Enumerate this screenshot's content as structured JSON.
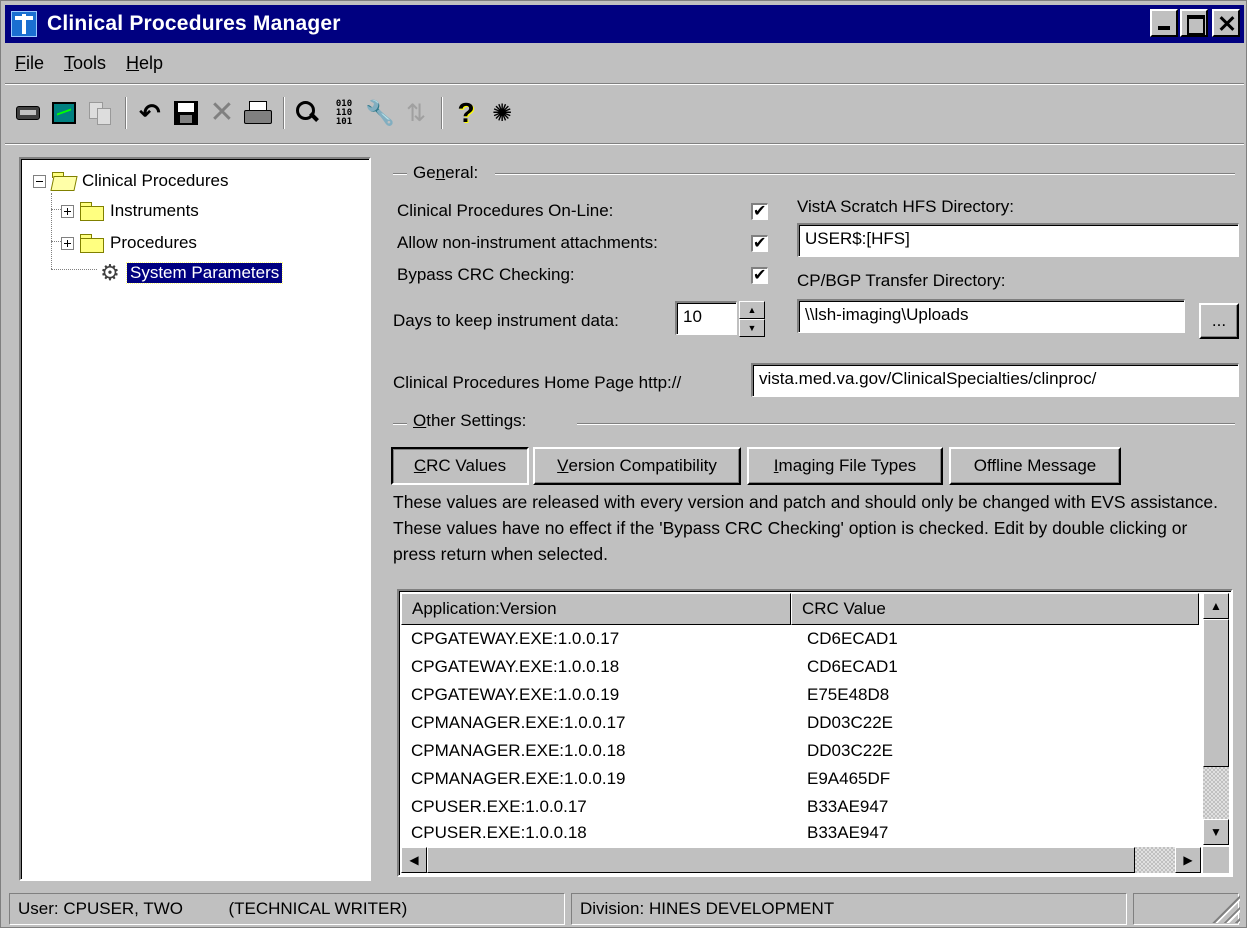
{
  "window": {
    "title": "Clinical Procedures Manager"
  },
  "menu": [
    {
      "label": "File",
      "accel": "F",
      "rest": "ile"
    },
    {
      "label": "Tools",
      "accel": "T",
      "rest": "ools"
    },
    {
      "label": "Help",
      "accel": "H",
      "rest": "elp"
    }
  ],
  "tree": {
    "root": "Clinical Procedures",
    "items": [
      "Instruments",
      "Procedures",
      "System Parameters"
    ],
    "selected": "System Parameters"
  },
  "general": {
    "heading_pre": "Ge",
    "heading_accel": "n",
    "heading_post": "eral:",
    "online_label": "Clinical Procedures On-Line:",
    "online_checked": true,
    "attach_label": "Allow non-instrument attachments:",
    "attach_checked": true,
    "bypass_label": "Bypass CRC Checking:",
    "bypass_checked": true,
    "days_label": "Days to keep instrument data:",
    "days_value": "10",
    "hfs_label": "VistA Scratch HFS Directory:",
    "hfs_value": "USER$:[HFS]",
    "transfer_label": "CP/BGP Transfer Directory:",
    "transfer_value": "\\\\lsh-imaging\\Uploads",
    "browse_label": "...",
    "homepage_label": "Clinical Procedures Home Page http://",
    "homepage_value": "vista.med.va.gov/ClinicalSpecialties/clinproc/"
  },
  "other": {
    "heading_accel": "O",
    "heading_rest": "ther Settings:",
    "tabs": [
      {
        "accel": "C",
        "rest": "RC Values",
        "pressed": true
      },
      {
        "accel": "V",
        "rest": "ersion Compatibility",
        "pressed": false
      },
      {
        "accel": "I",
        "rest": "maging File Types",
        "pressed": false
      },
      {
        "accel": "",
        "rest": "Offline Message",
        "pressed": false
      }
    ],
    "description": "These values are released with every version and patch and should only be changed with EVS assistance.  These values have no effect if the 'Bypass CRC Checking' option is checked.  Edit by double clicking or press return when selected."
  },
  "crc_table": {
    "columns": [
      "Application:Version",
      "CRC Value"
    ],
    "rows": [
      [
        "CPGATEWAY.EXE:1.0.0.17",
        "CD6ECAD1"
      ],
      [
        "CPGATEWAY.EXE:1.0.0.18",
        "CD6ECAD1"
      ],
      [
        "CPGATEWAY.EXE:1.0.0.19",
        "E75E48D8"
      ],
      [
        "CPMANAGER.EXE:1.0.0.17",
        "DD03C22E"
      ],
      [
        "CPMANAGER.EXE:1.0.0.18",
        "DD03C22E"
      ],
      [
        "CPMANAGER.EXE:1.0.0.19",
        "E9A465DF"
      ],
      [
        "CPUSER.EXE:1.0.0.17",
        "B33AE947"
      ],
      [
        "CPUSER.EXE:1.0.0.18",
        "B33AE947"
      ]
    ]
  },
  "status": {
    "user": "User: CPUSER, TWO",
    "role": "(TECHNICAL WRITER)",
    "division": "Division: HINES DEVELOPMENT",
    "extra": ""
  },
  "icons": [
    "card-icon",
    "monitor-icon",
    "copy-icon",
    "undo-icon",
    "save-icon",
    "delete-icon",
    "print-icon",
    "find-icon",
    "binary-icon",
    "wrench-icon",
    "refresh-icon",
    "help-icon",
    "debug-icon"
  ],
  "colors": {
    "titlebar": "#000080",
    "face": "#c0c0c0",
    "selection": "#000080"
  }
}
